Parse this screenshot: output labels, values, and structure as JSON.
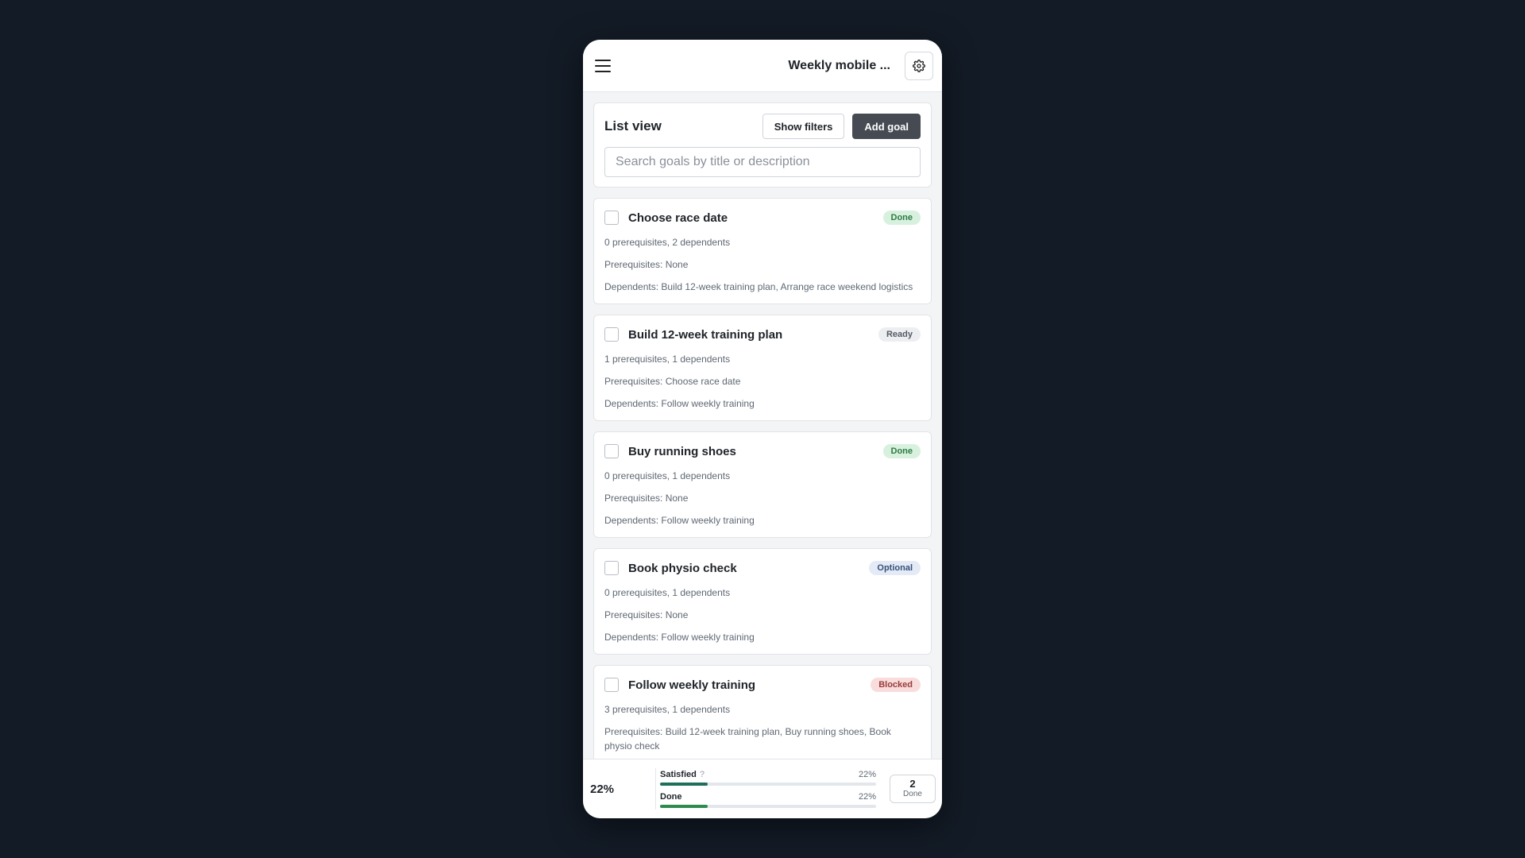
{
  "header": {
    "title": "Weekly mobile ...",
    "menu_icon": "hamburger-icon",
    "settings_icon": "gear-icon"
  },
  "list": {
    "title": "List view",
    "show_filters_label": "Show filters",
    "add_goal_label": "Add goal",
    "search_placeholder": "Search goals by title or description",
    "search_value": ""
  },
  "goals": [
    {
      "title": "Choose race date",
      "status": "Done",
      "counts": "0 prerequisites, 2 dependents",
      "prerequisites": "Prerequisites: None",
      "dependents": "Dependents: Build 12-week training plan, Arrange race weekend logistics"
    },
    {
      "title": "Build 12-week training plan",
      "status": "Ready",
      "counts": "1 prerequisites, 1 dependents",
      "prerequisites": "Prerequisites: Choose race date",
      "dependents": "Dependents: Follow weekly training"
    },
    {
      "title": "Buy running shoes",
      "status": "Done",
      "counts": "0 prerequisites, 1 dependents",
      "prerequisites": "Prerequisites: None",
      "dependents": "Dependents: Follow weekly training"
    },
    {
      "title": "Book physio check",
      "status": "Optional",
      "counts": "0 prerequisites, 1 dependents",
      "prerequisites": "Prerequisites: None",
      "dependents": "Dependents: Follow weekly training"
    },
    {
      "title": "Follow weekly training",
      "status": "Blocked",
      "counts": "3 prerequisites, 1 dependents",
      "prerequisites": "Prerequisites: Build 12-week training plan, Buy running shoes, Book physio check",
      "dependents": ""
    }
  ],
  "summary": {
    "overall_pct": "22%",
    "satisfied_label": "Satisfied",
    "satisfied_help": "?",
    "satisfied_pct": "22%",
    "satisfied_value": 0.22,
    "done_label": "Done",
    "done_pct": "22%",
    "done_value": 0.22,
    "done_count": "2",
    "done_count_label": "Done"
  },
  "colors": {
    "background": "#131b26",
    "satisfied_bar": "#1f6e5a",
    "done_bar": "#2e8b4e",
    "badge_done": "#d8f1de",
    "badge_ready": "#eceef1",
    "badge_optional": "#e4ebf6",
    "badge_blocked": "#f9dcdc"
  }
}
